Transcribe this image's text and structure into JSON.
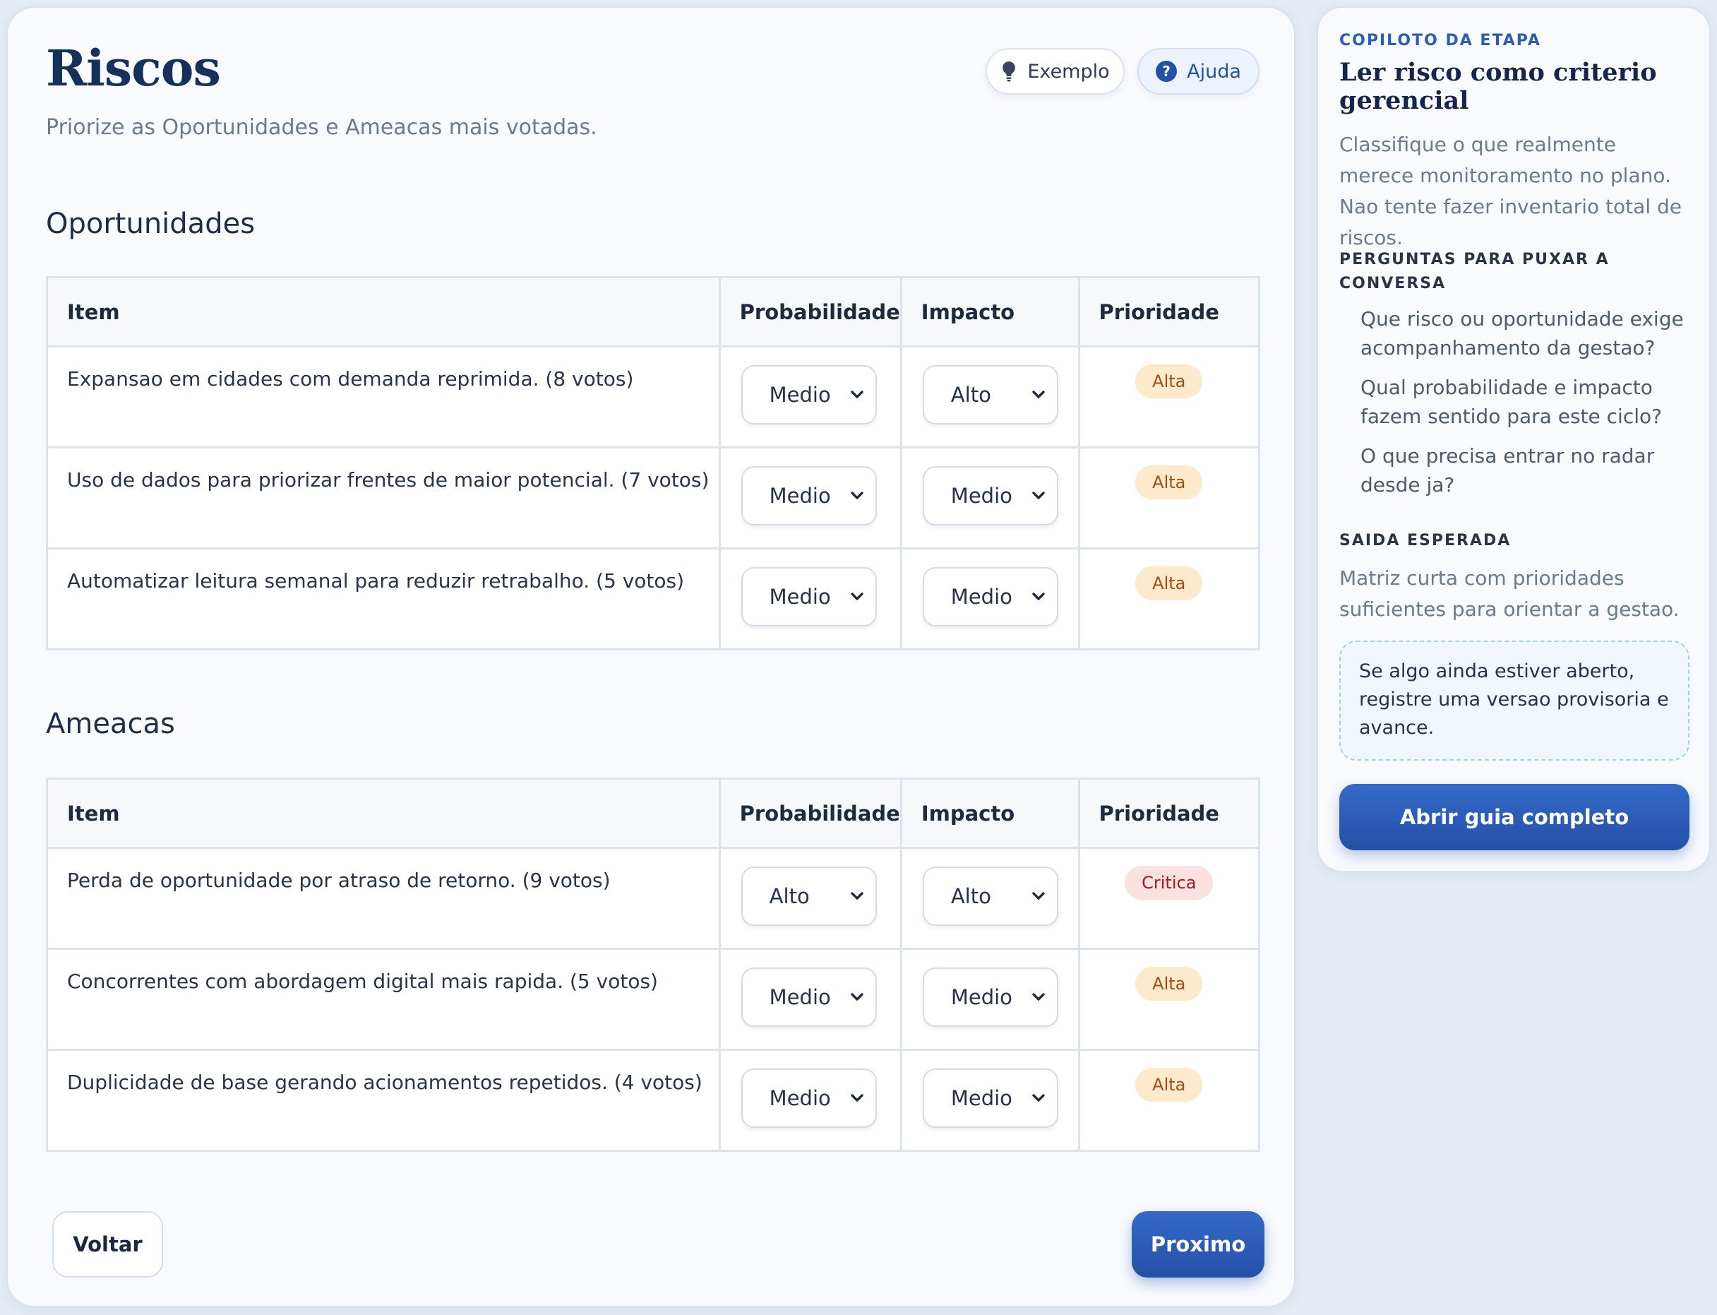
{
  "header": {
    "title": "Riscos",
    "subtitle": "Priorize as Oportunidades e Ameacas mais votadas.",
    "exemplo_label": "Exemplo",
    "ajuda_label": "Ajuda"
  },
  "columns": {
    "item": "Item",
    "probabilidade": "Probabilidade",
    "impacto": "Impacto",
    "prioridade": "Prioridade"
  },
  "oportunidades": {
    "title": "Oportunidades",
    "rows": [
      {
        "item": "Expansao em cidades com demanda reprimida. (8 votos)",
        "probabilidade": "Medio",
        "impacto": "Alto",
        "prioridade": "Alta"
      },
      {
        "item": "Uso de dados para priorizar frentes de maior potencial. (7 votos)",
        "probabilidade": "Medio",
        "impacto": "Medio",
        "prioridade": "Alta"
      },
      {
        "item": "Automatizar leitura semanal para reduzir retrabalho. (5 votos)",
        "probabilidade": "Medio",
        "impacto": "Medio",
        "prioridade": "Alta"
      }
    ]
  },
  "ameacas": {
    "title": "Ameacas",
    "rows": [
      {
        "item": "Perda de oportunidade por atraso de retorno. (9 votos)",
        "probabilidade": "Alto",
        "impacto": "Alto",
        "prioridade": "Critica"
      },
      {
        "item": "Concorrentes com abordagem digital mais rapida. (5 votos)",
        "probabilidade": "Medio",
        "impacto": "Medio",
        "prioridade": "Alta"
      },
      {
        "item": "Duplicidade de base gerando acionamentos repetidos. (4 votos)",
        "probabilidade": "Medio",
        "impacto": "Medio",
        "prioridade": "Alta"
      }
    ]
  },
  "footer": {
    "voltar_label": "Voltar",
    "proximo_label": "Proximo"
  },
  "sidebar": {
    "eyebrow": "COPILOTO DA ETAPA",
    "title": "Ler risco como criterio gerencial",
    "intro": "Classifique o que realmente merece monitoramento no plano. Nao tente fazer inventario total de riscos.",
    "questions_heading": "PERGUNTAS PARA PUXAR A CONVERSA",
    "questions": [
      "Que risco ou oportunidade exige acompanhamento da gestao?",
      "Qual probabilidade e impacto fazem sentido para este ciclo?",
      "O que precisa entrar no radar desde ja?"
    ],
    "output_heading": "SAIDA ESPERADA",
    "output_text": "Matriz curta com prioridades suficientes para orientar a gestao.",
    "note": "Se algo ainda estiver aberto, registre uma versao provisoria e avance.",
    "guide_button_label": "Abrir guia completo"
  },
  "colors": {
    "accent": "#2a5bb8",
    "title": "#16305c",
    "badge_alta_bg": "#fde9cc",
    "badge_critica_bg": "#fde1e1"
  },
  "icons": {
    "exemplo": "lightbulb-icon",
    "ajuda": "help-circle-icon",
    "select": "chevron-down-icon"
  }
}
